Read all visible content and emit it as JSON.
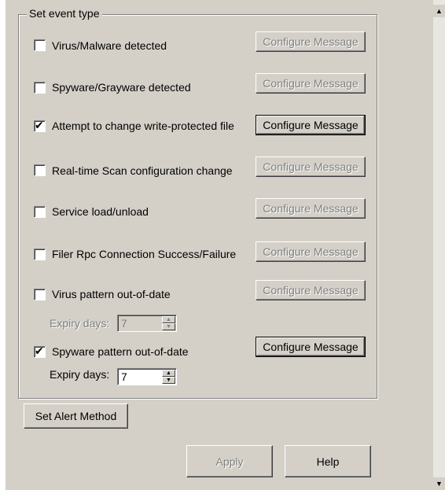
{
  "group": {
    "title": "Set event type"
  },
  "events": [
    {
      "label": "Virus/Malware detected",
      "checked": false,
      "button": "Configure Message",
      "button_enabled": false
    },
    {
      "label": "Spyware/Grayware detected",
      "checked": false,
      "button": "Configure Message",
      "button_enabled": false
    },
    {
      "label": "Attempt to change write-protected file",
      "checked": true,
      "button": "Configure Message",
      "button_enabled": true
    },
    {
      "label": "Real-time Scan configuration change",
      "checked": false,
      "button": "Configure Message",
      "button_enabled": false
    },
    {
      "label": "Service load/unload",
      "checked": false,
      "button": "Configure Message",
      "button_enabled": false
    },
    {
      "label": "Filer Rpc Connection Success/Failure",
      "checked": false,
      "button": "Configure Message",
      "button_enabled": false
    },
    {
      "label": "Virus pattern out-of-date",
      "checked": false,
      "button": "Configure Message",
      "button_enabled": false
    },
    {
      "label": "Spyware pattern out-of-date",
      "checked": true,
      "button": "Configure Message",
      "button_enabled": true
    }
  ],
  "expiry": [
    {
      "label": "Expiry days:",
      "value": "7",
      "enabled": false
    },
    {
      "label": "Expiry days:",
      "value": "7",
      "enabled": true
    }
  ],
  "buttons": {
    "set_alert": "Set Alert Method",
    "apply": "Apply",
    "help": "Help"
  },
  "icons": {
    "check": "checkmark-icon",
    "spin_up": "spin-up-arrow-icon",
    "spin_down": "spin-down-arrow-icon",
    "scroll_up": "scroll-up-arrow-icon",
    "scroll_down": "scroll-down-arrow-icon"
  }
}
